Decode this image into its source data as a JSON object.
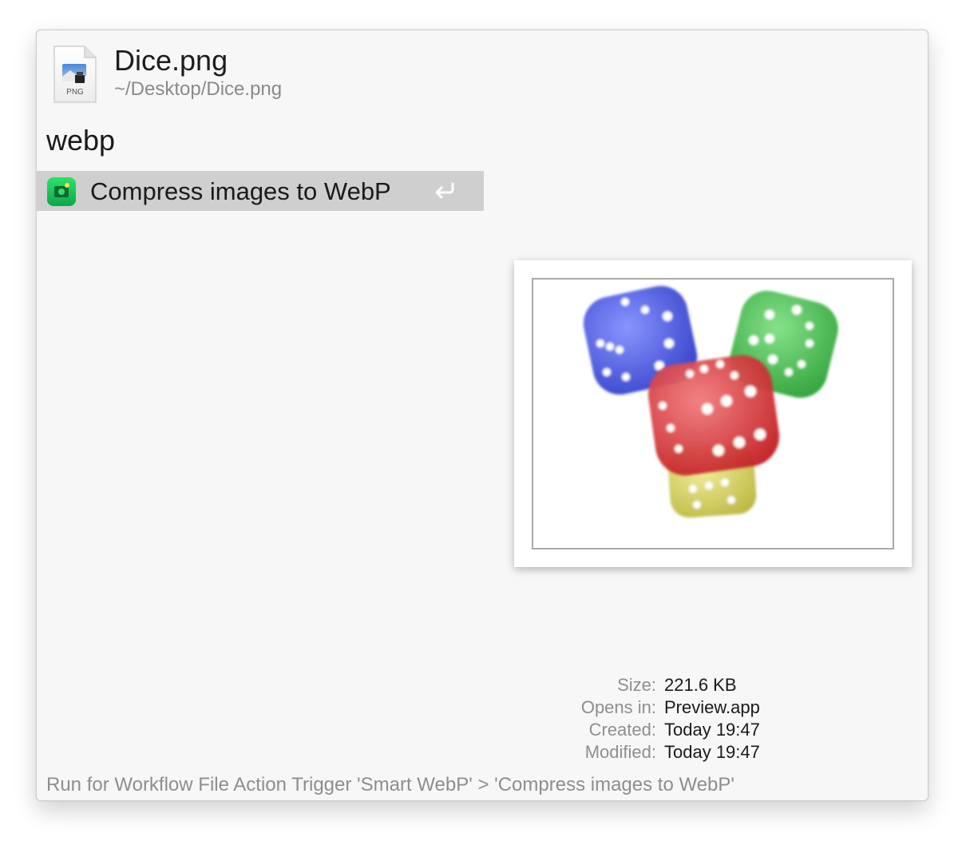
{
  "file": {
    "name": "Dice.png",
    "path": "~/Desktop/Dice.png",
    "icon_label": "PNG",
    "icon": "png-file-icon"
  },
  "search": {
    "query": "webp"
  },
  "results": [
    {
      "label": "Compress images to WebP",
      "icon": "webp-workflow-icon",
      "action_hint": "return-key-icon"
    }
  ],
  "preview": {
    "image": "dice-image",
    "dice_colors": {
      "blue": "#3b4fd6",
      "green": "#3fbf4a",
      "red": "#d8383b",
      "yellow": "#c9c33a"
    }
  },
  "metadata": [
    {
      "key": "Size:",
      "value": "221.6 KB"
    },
    {
      "key": "Opens in:",
      "value": "Preview.app"
    },
    {
      "key": "Created:",
      "value": "Today 19:47"
    },
    {
      "key": "Modified:",
      "value": "Today 19:47"
    }
  ],
  "footer": {
    "subtext": "Run for Workflow File Action Trigger 'Smart WebP' > 'Compress images to WebP'"
  },
  "colors": {
    "window_bg": "#f7f7f7",
    "selection_bg": "#cfcfcf",
    "text_primary": "#1a1a1a",
    "text_secondary": "#8e8e8e"
  }
}
